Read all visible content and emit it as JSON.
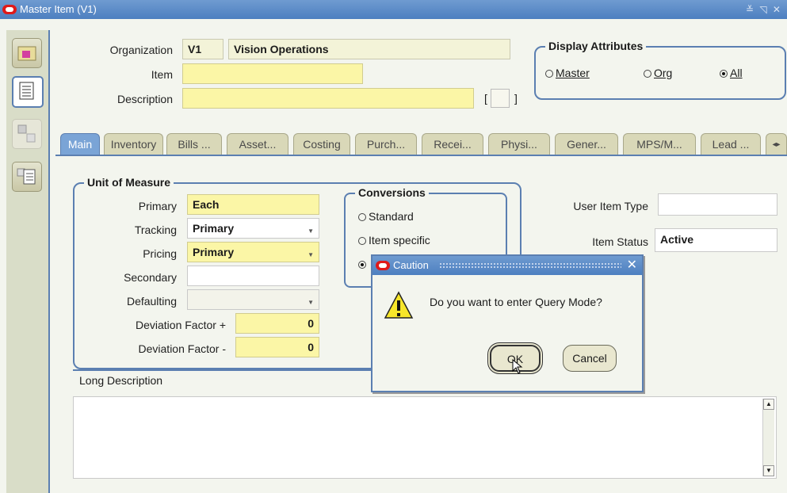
{
  "window": {
    "title": "Master Item (V1)",
    "controls": "≚ ◹ ✕"
  },
  "header": {
    "organization_label": "Organization",
    "organization_code": "V1",
    "organization_name": "Vision Operations",
    "item_label": "Item",
    "item_value": "",
    "description_label": "Description",
    "description_value": "",
    "bracket_left": "[",
    "bracket_right": "]"
  },
  "display_attributes": {
    "title": "Display Attributes",
    "options": [
      {
        "label": "Master",
        "selected": false
      },
      {
        "label": "Org",
        "selected": false
      },
      {
        "label": "All",
        "selected": true
      }
    ]
  },
  "tabs": [
    "Main",
    "Inventory",
    "Bills ...",
    "Asset...",
    "Costing",
    "Purch...",
    "Recei...",
    "Physi...",
    "Gener...",
    "MPS/M...",
    "Lead ..."
  ],
  "tab_scroll_icon": "◂▸",
  "uom": {
    "title": "Unit of Measure",
    "primary_label": "Primary",
    "primary_value": "Each",
    "tracking_label": "Tracking",
    "tracking_value": "Primary",
    "pricing_label": "Pricing",
    "pricing_value": "Primary",
    "secondary_label": "Secondary",
    "secondary_value": "",
    "defaulting_label": "Defaulting",
    "defaulting_value": "",
    "dev_plus_label": "Deviation Factor +",
    "dev_plus_value": "0",
    "dev_minus_label": "Deviation Factor -",
    "dev_minus_value": "0"
  },
  "conversions": {
    "title": "Conversions",
    "options": [
      {
        "label": "Standard",
        "selected": false
      },
      {
        "label": "Item specific",
        "selected": false
      },
      {
        "label": "",
        "selected": true
      }
    ]
  },
  "right_fields": {
    "user_item_type_label": "User Item Type",
    "user_item_type_value": "",
    "item_status_label": "Item Status",
    "item_status_value": "Active"
  },
  "long_description": {
    "label": "Long Description",
    "value": ""
  },
  "dialog": {
    "title": "Caution",
    "message": "Do you want to enter Query Mode?",
    "ok_label": "OK",
    "cancel_label": "Cancel",
    "close_icon": "✕"
  },
  "colors": {
    "accent": "#5b7fb1",
    "required": "#fbf6a6",
    "active_tab": "#7aa4d6"
  }
}
